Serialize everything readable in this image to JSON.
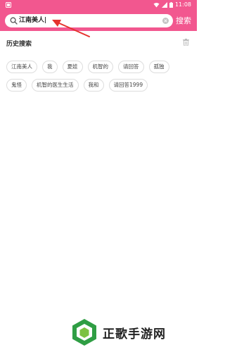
{
  "status_bar": {
    "time": "11:08"
  },
  "search": {
    "query": "江南美人",
    "submit_label": "搜索"
  },
  "history": {
    "title": "历史搜索",
    "rows": [
      [
        "江南美人",
        "我",
        "夏娃",
        "机智的",
        "请回答",
        "孤独"
      ],
      [
        "鬼怪",
        "机智的医生生活",
        "我和",
        "请回答1999"
      ]
    ]
  },
  "watermark": {
    "text": "正歌手游网"
  },
  "colors": {
    "header": "#f2578f",
    "annotation": "#e5322d"
  }
}
